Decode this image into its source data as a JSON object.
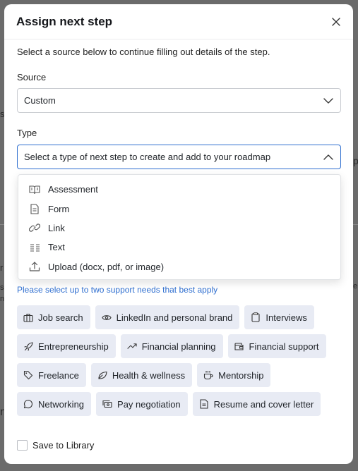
{
  "modal": {
    "title": "Assign next step",
    "intro": "Select a source below to continue filling out details of the step."
  },
  "source": {
    "label": "Source",
    "value": "Custom"
  },
  "type": {
    "label": "Type",
    "placeholder": "Select a type of next step to create and add to your roadmap",
    "options": [
      {
        "label": "Assessment",
        "icon": "book-open-icon"
      },
      {
        "label": "Form",
        "icon": "file-text-icon"
      },
      {
        "label": "Link",
        "icon": "link-icon"
      },
      {
        "label": "Text",
        "icon": "text-columns-icon"
      },
      {
        "label": "Upload (docx, pdf, or image)",
        "icon": "upload-icon"
      }
    ]
  },
  "support": {
    "helper": "Please select up to two support needs that best apply",
    "tags": [
      {
        "label": "Job search",
        "icon": "briefcase-icon"
      },
      {
        "label": "LinkedIn and personal brand",
        "icon": "eye-icon"
      },
      {
        "label": "Interviews",
        "icon": "clipboard-icon"
      },
      {
        "label": "Entrepreneurship",
        "icon": "rocket-icon"
      },
      {
        "label": "Financial planning",
        "icon": "trend-up-icon"
      },
      {
        "label": "Financial support",
        "icon": "wallet-icon"
      },
      {
        "label": "Freelance",
        "icon": "tag-icon"
      },
      {
        "label": "Health & wellness",
        "icon": "leaf-icon"
      },
      {
        "label": "Mentorship",
        "icon": "coffee-icon"
      },
      {
        "label": "Networking",
        "icon": "chat-icon"
      },
      {
        "label": "Pay negotiation",
        "icon": "money-icon"
      },
      {
        "label": "Resume and cover letter",
        "icon": "document-icon"
      }
    ]
  },
  "save_to_library": {
    "label": "Save to Library",
    "checked": false
  },
  "colors": {
    "accent": "#2f6fd0",
    "chip_bg": "#e8ebf4",
    "overlay": "#6b6b6b"
  }
}
